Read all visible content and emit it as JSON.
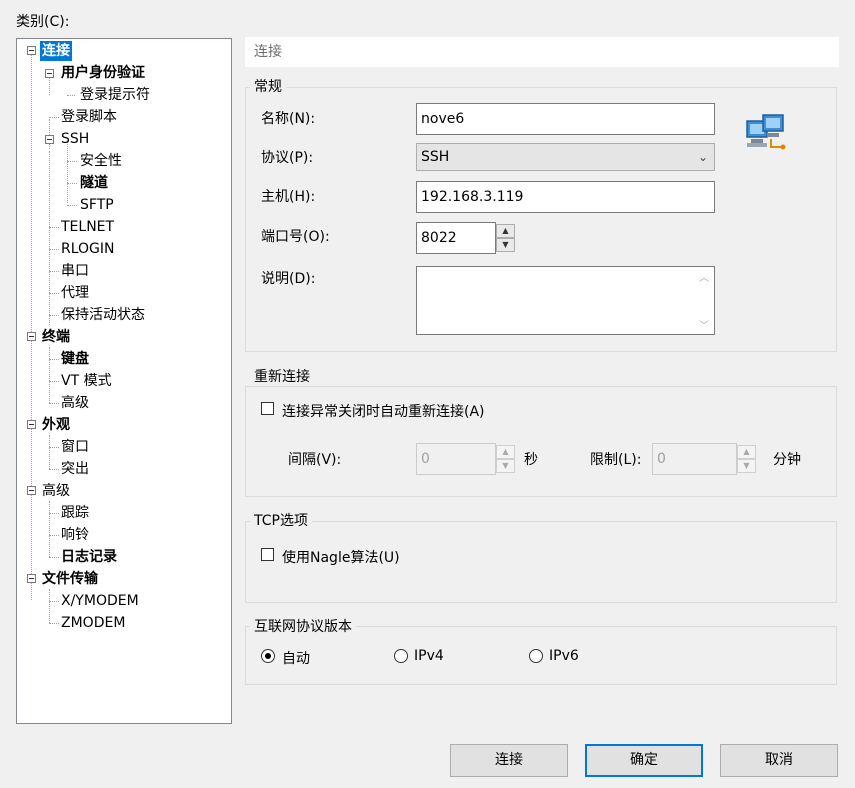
{
  "category_label": "类别(C):",
  "tree": {
    "items": [
      {
        "label": "连接"
      },
      {
        "label": "用户身份验证"
      },
      {
        "label": "登录提示符"
      },
      {
        "label": "登录脚本"
      },
      {
        "label": "SSH"
      },
      {
        "label": "安全性"
      },
      {
        "label": "隧道"
      },
      {
        "label": "SFTP"
      },
      {
        "label": "TELNET"
      },
      {
        "label": "RLOGIN"
      },
      {
        "label": "串口"
      },
      {
        "label": "代理"
      },
      {
        "label": "保持活动状态"
      },
      {
        "label": "终端"
      },
      {
        "label": "键盘"
      },
      {
        "label": "VT 模式"
      },
      {
        "label": "高级"
      },
      {
        "label": "外观"
      },
      {
        "label": "窗口"
      },
      {
        "label": "突出"
      },
      {
        "label": "高级"
      },
      {
        "label": "跟踪"
      },
      {
        "label": "响铃"
      },
      {
        "label": "日志记录"
      },
      {
        "label": "文件传输"
      },
      {
        "label": "X/YMODEM"
      },
      {
        "label": "ZMODEM"
      }
    ]
  },
  "header": {
    "title": "连接"
  },
  "general": {
    "title": "常规",
    "name_label": "名称(N):",
    "name_value": "nove6",
    "protocol_label": "协议(P):",
    "protocol_value": "SSH",
    "host_label": "主机(H):",
    "host_value": "192.168.3.119",
    "port_label": "端口号(O):",
    "port_value": "8022",
    "desc_label": "说明(D):",
    "desc_value": ""
  },
  "reconnect": {
    "title": "重新连接",
    "checkbox_label": "连接异常关闭时自动重新连接(A)",
    "interval_label": "间隔(V):",
    "interval_value": "0",
    "interval_unit": "秒",
    "limit_label": "限制(L):",
    "limit_value": "0",
    "limit_unit": "分钟"
  },
  "tcp": {
    "title": "TCP选项",
    "nagle_label": "使用Nagle算法(U)"
  },
  "ipver": {
    "title": "互联网协议版本",
    "options": [
      {
        "label": "自动",
        "selected": true
      },
      {
        "label": "IPv4",
        "selected": false
      },
      {
        "label": "IPv6",
        "selected": false
      }
    ]
  },
  "buttons": {
    "connect": "连接",
    "ok": "确定",
    "cancel": "取消"
  },
  "colors": {
    "selection": "#0078d7",
    "default_button_border": "#0078d7"
  },
  "icons": [
    "network-computer-icon",
    "chevron-down-icon",
    "spin-up-icon",
    "spin-down-icon"
  ]
}
